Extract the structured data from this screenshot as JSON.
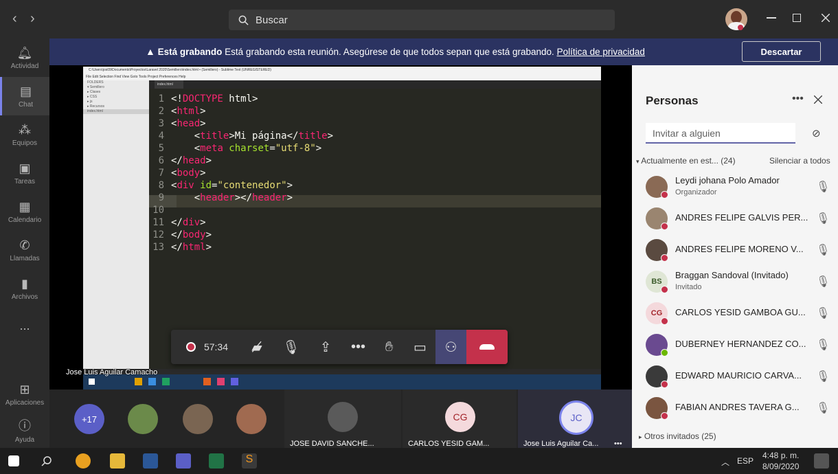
{
  "window": {
    "search_placeholder": "Buscar",
    "nav_back": "‹",
    "nav_forward": "›"
  },
  "rail": {
    "items": [
      {
        "label": "Actividad",
        "icon": "bell-icon"
      },
      {
        "label": "Chat",
        "icon": "chat-icon"
      },
      {
        "label": "Equipos",
        "icon": "teams-icon"
      },
      {
        "label": "Tareas",
        "icon": "tasks-icon"
      },
      {
        "label": "Calendario",
        "icon": "calendar-icon"
      },
      {
        "label": "Llamadas",
        "icon": "phone-icon"
      },
      {
        "label": "Archivos",
        "icon": "files-icon"
      },
      {
        "label": "...",
        "icon": "more-icon"
      },
      {
        "label": "Aplicaciones",
        "icon": "apps-icon"
      },
      {
        "label": "Ayuda",
        "icon": "help-icon"
      }
    ]
  },
  "banner": {
    "bold": "Está grabando",
    "text": "Está grabando esta reunión. Asegúrese de que todos sepan que está grabando.",
    "link": "Política de privacidad",
    "dismiss": "Descartar"
  },
  "shared_screen": {
    "title": "C:\\Users\\jos09\\Documents\\Proyectos\\Laravel 2020\\Semillero\\index.html • (Semillero) - Sublime Text (UNREGISTERED)",
    "menu": "File  Edit  Selection  Find  View  Goto  Tools  Project  Preferences  Help",
    "folders": [
      "FOLDERS",
      "▾ Semillero",
      "▸ Clases",
      "▸ CSS",
      "▸ js",
      "▸ Recursos",
      "index.html"
    ],
    "tab": "index.html",
    "code": [
      {
        "n": "1",
        "parts": [
          [
            "",
            "<!"
          ],
          [
            "tag",
            "DOCTYPE"
          ],
          [
            "",
            " html>"
          ]
        ]
      },
      {
        "n": "2",
        "parts": [
          [
            "",
            "<"
          ],
          [
            "tag",
            "html"
          ],
          [
            "",
            ">"
          ]
        ]
      },
      {
        "n": "3",
        "parts": [
          [
            "",
            "<"
          ],
          [
            "tag",
            "head"
          ],
          [
            "",
            ">"
          ]
        ]
      },
      {
        "n": "4",
        "parts": [
          [
            "",
            "    <"
          ],
          [
            "tag",
            "title"
          ],
          [
            "",
            ">Mi página</"
          ],
          [
            "tag",
            "title"
          ],
          [
            "",
            ">"
          ]
        ]
      },
      {
        "n": "5",
        "parts": [
          [
            "",
            "    <"
          ],
          [
            "tag",
            "meta"
          ],
          [
            "att",
            " charset"
          ],
          [
            "",
            "="
          ],
          [
            "str",
            "\"utf-8\""
          ],
          [
            "",
            ">"
          ]
        ]
      },
      {
        "n": "6",
        "parts": [
          [
            "",
            "</"
          ],
          [
            "tag",
            "head"
          ],
          [
            "",
            ">"
          ]
        ]
      },
      {
        "n": "7",
        "parts": [
          [
            "",
            "<"
          ],
          [
            "tag",
            "body"
          ],
          [
            "",
            ">"
          ]
        ]
      },
      {
        "n": "8",
        "parts": [
          [
            "",
            "<"
          ],
          [
            "tag",
            "div"
          ],
          [
            "att",
            " id"
          ],
          [
            "",
            "="
          ],
          [
            "str",
            "\"contenedor\""
          ],
          [
            "",
            ">"
          ]
        ]
      },
      {
        "n": "9",
        "parts": [
          [
            "",
            "    <"
          ],
          [
            "tag",
            "header"
          ],
          [
            "",
            "></"
          ],
          [
            "tag",
            "header"
          ],
          [
            "",
            ">"
          ]
        ]
      },
      {
        "n": "10",
        "parts": [
          [
            "",
            ""
          ]
        ]
      },
      {
        "n": "11",
        "parts": [
          [
            "",
            "</"
          ],
          [
            "tag",
            "div"
          ],
          [
            "",
            ">"
          ]
        ]
      },
      {
        "n": "12",
        "parts": [
          [
            "",
            "</"
          ],
          [
            "tag",
            "body"
          ],
          [
            "",
            ">"
          ]
        ]
      },
      {
        "n": "13",
        "parts": [
          [
            "",
            "</"
          ],
          [
            "tag",
            "html"
          ],
          [
            "",
            ">"
          ]
        ]
      }
    ],
    "presenter": "Jose Luis Aguilar Camacho"
  },
  "controls": {
    "timer": "57:34"
  },
  "people": {
    "title": "Personas",
    "invite_placeholder": "Invitar a alguien",
    "section": "Actualmente en est... (24)",
    "mute_all": "Silenciar a todos",
    "others": "Otros invitados (25)",
    "list": [
      {
        "name": "Leydi johana Polo Amador",
        "role": "Organizador",
        "initials": "",
        "color": "#8a6a55"
      },
      {
        "name": "ANDRES FELIPE GALVIS PER...",
        "role": "",
        "initials": "",
        "color": "#9a8570"
      },
      {
        "name": "ANDRES FELIPE MORENO V...",
        "role": "",
        "initials": "",
        "color": "#5a4a40"
      },
      {
        "name": "Braggan Sandoval (Invitado)",
        "role": "Invitado",
        "initials": "BS",
        "color": "#dfe6d5"
      },
      {
        "name": "CARLOS YESID GAMBOA GU...",
        "role": "",
        "initials": "CG",
        "color": "#f4d9dc"
      },
      {
        "name": "DUBERNEY HERNANDEZ CO...",
        "role": "",
        "initials": "",
        "color": "#6a4a90"
      },
      {
        "name": "EDWARD MAURICIO CARVA...",
        "role": "",
        "initials": "",
        "color": "#3a3a3a"
      },
      {
        "name": "FABIAN ANDRES TAVERA G...",
        "role": "",
        "initials": "",
        "color": "#7a5540"
      }
    ]
  },
  "strip": {
    "more": "+17",
    "tiles": [
      {
        "name": "JOSE DAVID SANCHE...",
        "initials": ""
      },
      {
        "name": "CARLOS YESID GAM...",
        "initials": "CG"
      },
      {
        "name": "Jose Luis Aguilar Ca...",
        "initials": "JC"
      }
    ]
  },
  "taskbar": {
    "lang": "ESP",
    "time": "4:48 p. m.",
    "date": "8/09/2020"
  }
}
